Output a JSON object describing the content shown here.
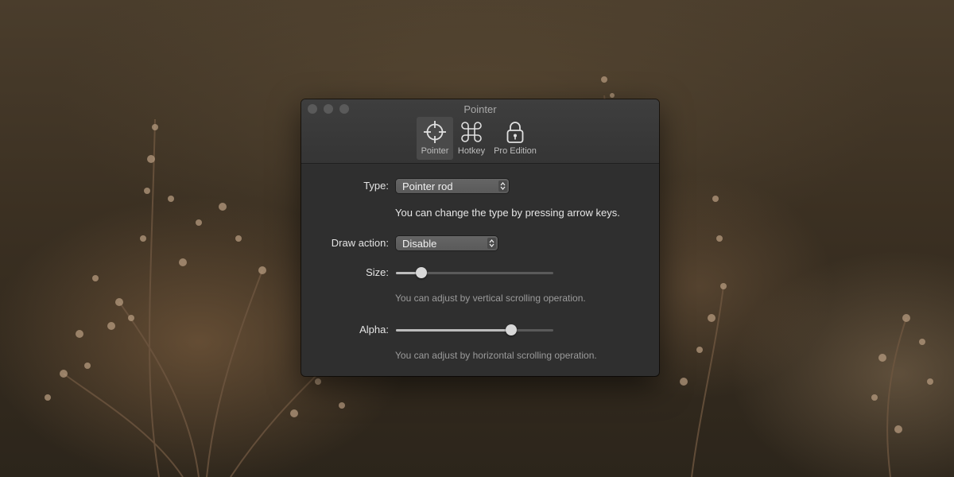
{
  "window": {
    "title": "Pointer"
  },
  "tabs": [
    {
      "label": "Pointer",
      "icon": "crosshair-icon",
      "active": true
    },
    {
      "label": "Hotkey",
      "icon": "command-icon",
      "active": false
    },
    {
      "label": "Pro Edition",
      "icon": "padlock-icon",
      "active": false
    }
  ],
  "settings": {
    "type": {
      "label": "Type:",
      "value": "Pointer rod",
      "hint": "You can change the type by pressing arrow keys."
    },
    "draw_action": {
      "label": "Draw action:",
      "value": "Disable"
    },
    "size": {
      "label": "Size:",
      "level": 0.16,
      "hint": "You can adjust by vertical scrolling operation."
    },
    "alpha": {
      "label": "Alpha:",
      "level": 0.73,
      "hint": "You can adjust by horizontal scrolling operation."
    }
  }
}
